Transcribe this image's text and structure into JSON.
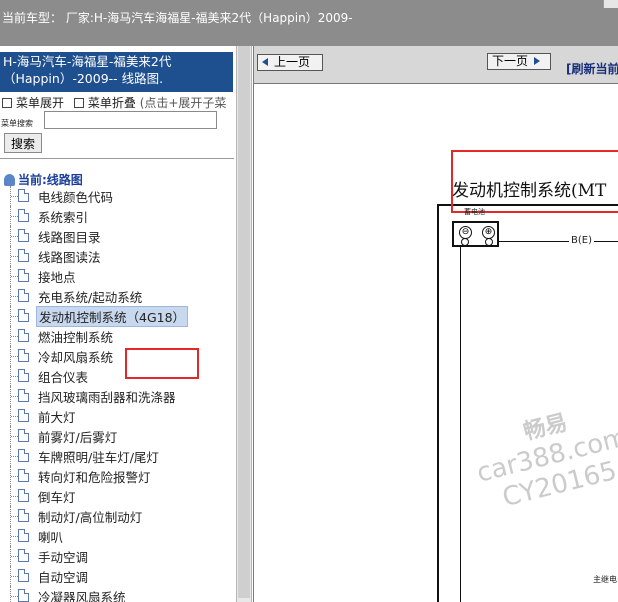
{
  "topbar": {
    "vehicle_label": "当前车型：  厂家:H-海马汽车海福星-福美来2代（Happin）2009-"
  },
  "sidebar": {
    "title": "H-海马汽车-海福星-福美来2代（Happin）-2009-- 线路图.",
    "expand_label": "菜单展开",
    "collapse_label": "菜单折叠",
    "hint": "(点击+展开子菜",
    "search_label": "菜单搜索",
    "search_value": "",
    "search_button": "搜索",
    "current_label": "当前:线路图",
    "items": [
      "电线颜色代码",
      "系统索引",
      "线路图目录",
      "线路图读法",
      "接地点",
      "充电系统/起动系统",
      "发动机控制系统（4G18）",
      "燃油控制系统",
      "冷却风扇系统",
      "组合仪表",
      "挡风玻璃雨刮器和洗涤器",
      "前大灯",
      "前雾灯/后雾灯",
      "车牌照明/驻车灯/尾灯",
      "转向灯和危险报警灯",
      "倒车灯",
      "制动灯/高位制动灯",
      "喇叭",
      "手动空调",
      "自动空调",
      "冷凝器风扇系统"
    ],
    "selected_index": 6
  },
  "toolbar": {
    "prev_label": "上一页",
    "next_label": "下一页",
    "refresh_label": "[刷新当前"
  },
  "diagram": {
    "title": "发动机控制系统(MT",
    "top_label": "蓄电池",
    "wire_label": "B(E)",
    "side_label": "主继电",
    "connector_terminals": [
      "⊖",
      "⊕"
    ]
  },
  "watermark": {
    "line1": "畅易",
    "line2": "car388.com",
    "line3": "CY20165"
  },
  "colors": {
    "topbar_bg": "#8c8c8c",
    "title_bg": "#1e4f8f",
    "highlight_box": "#e22828",
    "selected_bg": "#c8d9ef"
  }
}
